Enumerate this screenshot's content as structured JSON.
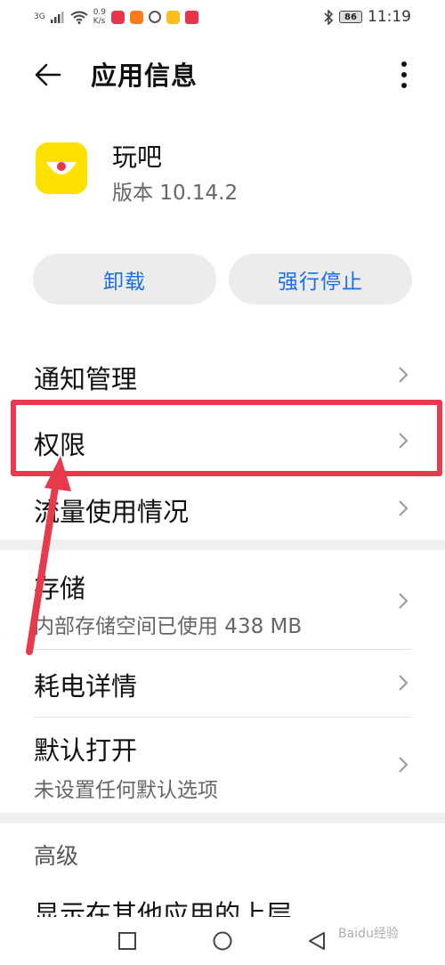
{
  "status_bar": {
    "net_type": "3G",
    "speed_value": "0.9",
    "speed_unit": "K/s",
    "battery": "86",
    "time": "11:19"
  },
  "header": {
    "title": "应用信息"
  },
  "app": {
    "name": "玩吧",
    "version": "版本 10.14.2"
  },
  "actions": {
    "uninstall": "卸载",
    "force_stop": "强行停止"
  },
  "settings": {
    "notification": "通知管理",
    "permissions": "权限",
    "data_usage": "流量使用情况",
    "storage": "存储",
    "storage_detail": "内部存储空间已使用 438 MB",
    "battery_usage": "耗电详情",
    "open_by_default": "默认打开",
    "open_by_default_detail": "未设置任何默认选项",
    "advanced_header": "高级",
    "display_over": "显示在其他应用的上层"
  },
  "watermark": "Baidu经验",
  "colors": {
    "accent_blue": "#1a6ee6",
    "annotation_red": "#e73a4c",
    "app_icon_yellow": "#ffe100"
  }
}
